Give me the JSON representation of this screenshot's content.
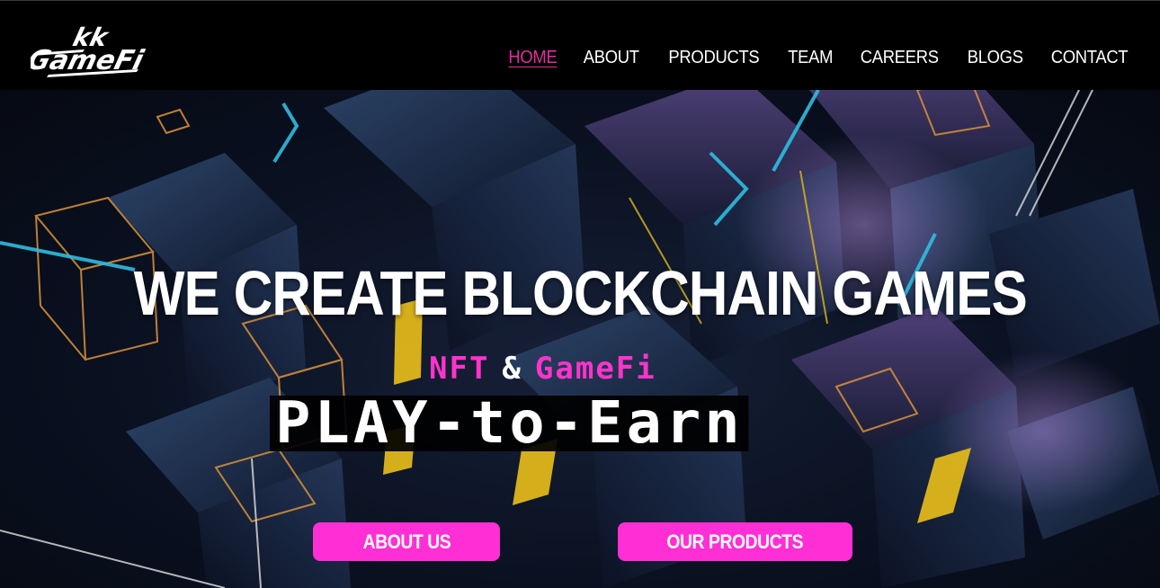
{
  "header": {
    "logo": {
      "text_top": "kk",
      "text_bottom": "GameFi"
    },
    "nav": [
      {
        "label": "HOME",
        "active": true
      },
      {
        "label": "ABOUT",
        "active": false
      },
      {
        "label": "PRODUCTS",
        "active": false
      },
      {
        "label": "TEAM",
        "active": false
      },
      {
        "label": "CAREERS",
        "active": false
      },
      {
        "label": "BLOGS",
        "active": false
      },
      {
        "label": "CONTACT",
        "active": false
      }
    ]
  },
  "hero": {
    "title": "WE CREATE BLOCKCHAIN GAMES",
    "tag_left": "NFT",
    "tag_amp": "&",
    "tag_right": "GameFi",
    "play_text": "PLAY-to-Earn",
    "buttons": {
      "about": "ABOUT US",
      "products": "OUR PRODUCTS"
    }
  },
  "colors": {
    "accent_pink": "#ff2ed5",
    "nav_active": "#e0309f",
    "header_bg": "#000000"
  }
}
